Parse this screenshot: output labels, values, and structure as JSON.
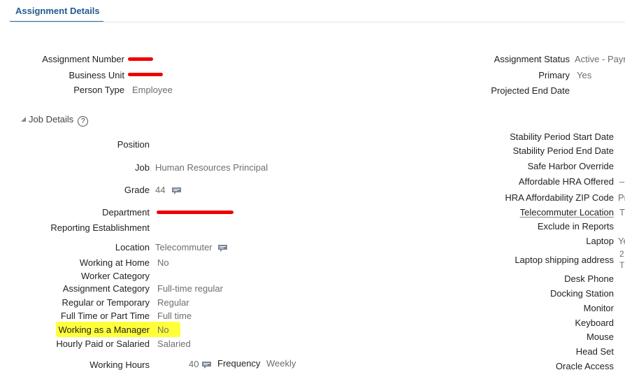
{
  "tab": {
    "label": "Assignment Details"
  },
  "header": {
    "assignment_number_label": "Assignment Number",
    "business_unit_label": "Business Unit",
    "person_type_label": "Person Type",
    "person_type_value": "Employee",
    "assignment_status_label": "Assignment Status",
    "assignment_status_value": "Active - Payr",
    "primary_label": "Primary",
    "primary_value": "Yes",
    "projected_end_date_label": "Projected End Date"
  },
  "job_details": {
    "title": "Job Details",
    "help_glyph": "?",
    "position_label": "Position",
    "job_label": "Job",
    "job_value": "Human Resources Principal",
    "grade_label": "Grade",
    "grade_value": "44",
    "department_label": "Department",
    "reporting_establishment_label": "Reporting Establishment",
    "location_label": "Location",
    "location_value": "Telecommuter",
    "working_at_home_label": "Working at Home",
    "working_at_home_value": "No",
    "worker_category_label": "Worker Category",
    "assignment_category_label": "Assignment Category",
    "assignment_category_value": "Full-time regular",
    "regular_temporary_label": "Regular or Temporary",
    "regular_temporary_value": "Regular",
    "full_part_time_label": "Full Time or Part Time",
    "full_part_time_value": "Full time",
    "working_as_manager_label": "Working as a Manager",
    "working_as_manager_value": "No",
    "hourly_salaried_label": "Hourly Paid or Salaried",
    "hourly_salaried_value": "Salaried",
    "working_hours_label": "Working Hours",
    "working_hours_value": "40",
    "frequency_label": "Frequency",
    "frequency_value": "Weekly"
  },
  "right_fields": {
    "stability_start_label": "Stability Period Start Date",
    "stability_end_label": "Stability Period End Date",
    "safe_harbor_label": "Safe Harbor Override",
    "affordable_hra_label": "Affordable HRA Offered",
    "affordable_hra_value": "–",
    "hra_zip_label": "HRA Affordability ZIP Code",
    "hra_zip_value": "Pr",
    "telecommuter_location_label": "Telecommuter Location",
    "telecommuter_location_value": "T",
    "exclude_reports_label": "Exclude in Reports",
    "laptop_label": "Laptop",
    "laptop_value": "Ye",
    "laptop_shipping_label": "Laptop shipping address",
    "laptop_shipping_value_1": "2",
    "laptop_shipping_value_2": "T",
    "desk_phone_label": "Desk Phone",
    "docking_station_label": "Docking Station",
    "monitor_label": "Monitor",
    "keyboard_label": "Keyboard",
    "mouse_label": "Mouse",
    "head_set_label": "Head Set",
    "oracle_access_label": "Oracle Access"
  },
  "icons": {
    "note": "note-icon",
    "collapse": "collapse-triangle-icon",
    "help": "help-icon"
  },
  "colors": {
    "tab_accent": "#2d6aa8",
    "redaction": "#ee0000",
    "highlight": "#ffff3a"
  }
}
